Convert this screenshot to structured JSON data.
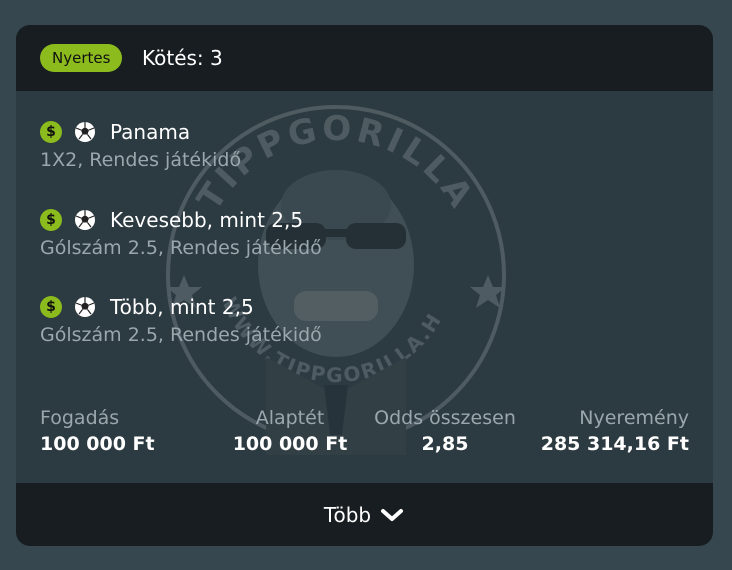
{
  "header": {
    "status_badge": "Nyertes",
    "title": "Kötés: 3"
  },
  "watermark": {
    "text_top": "TIPPGORILLA",
    "text_bottom": "WWW.TIPPGORILLA.HU"
  },
  "bets": [
    {
      "name": "Panama",
      "market": "1X2, Rendes játékidő",
      "win_icon": "dollar-icon",
      "sport_icon": "soccer-ball-icon"
    },
    {
      "name": "Kevesebb, mint 2,5",
      "market": "Gólszám 2.5, Rendes játékidő",
      "win_icon": "dollar-icon",
      "sport_icon": "soccer-ball-icon"
    },
    {
      "name": "Több, mint 2,5",
      "market": "Gólszám 2.5, Rendes játékidő",
      "win_icon": "dollar-icon",
      "sport_icon": "soccer-ball-icon"
    }
  ],
  "stats": {
    "stake": {
      "label": "Fogadás",
      "value": "100 000 Ft"
    },
    "base_stake": {
      "label": "Alaptét",
      "value": "100 000 Ft"
    },
    "total_odds": {
      "label": "Odds összesen",
      "value": "2,85"
    },
    "winnings": {
      "label": "Nyeremény",
      "value": "285 314,16 Ft"
    }
  },
  "footer": {
    "more_label": "Több"
  },
  "colors": {
    "accent": "#8cbb1e",
    "card_bg": "#2c3a41",
    "header_bg": "#171d21",
    "page_bg": "#36474f",
    "muted_text": "#9aa8ae"
  }
}
